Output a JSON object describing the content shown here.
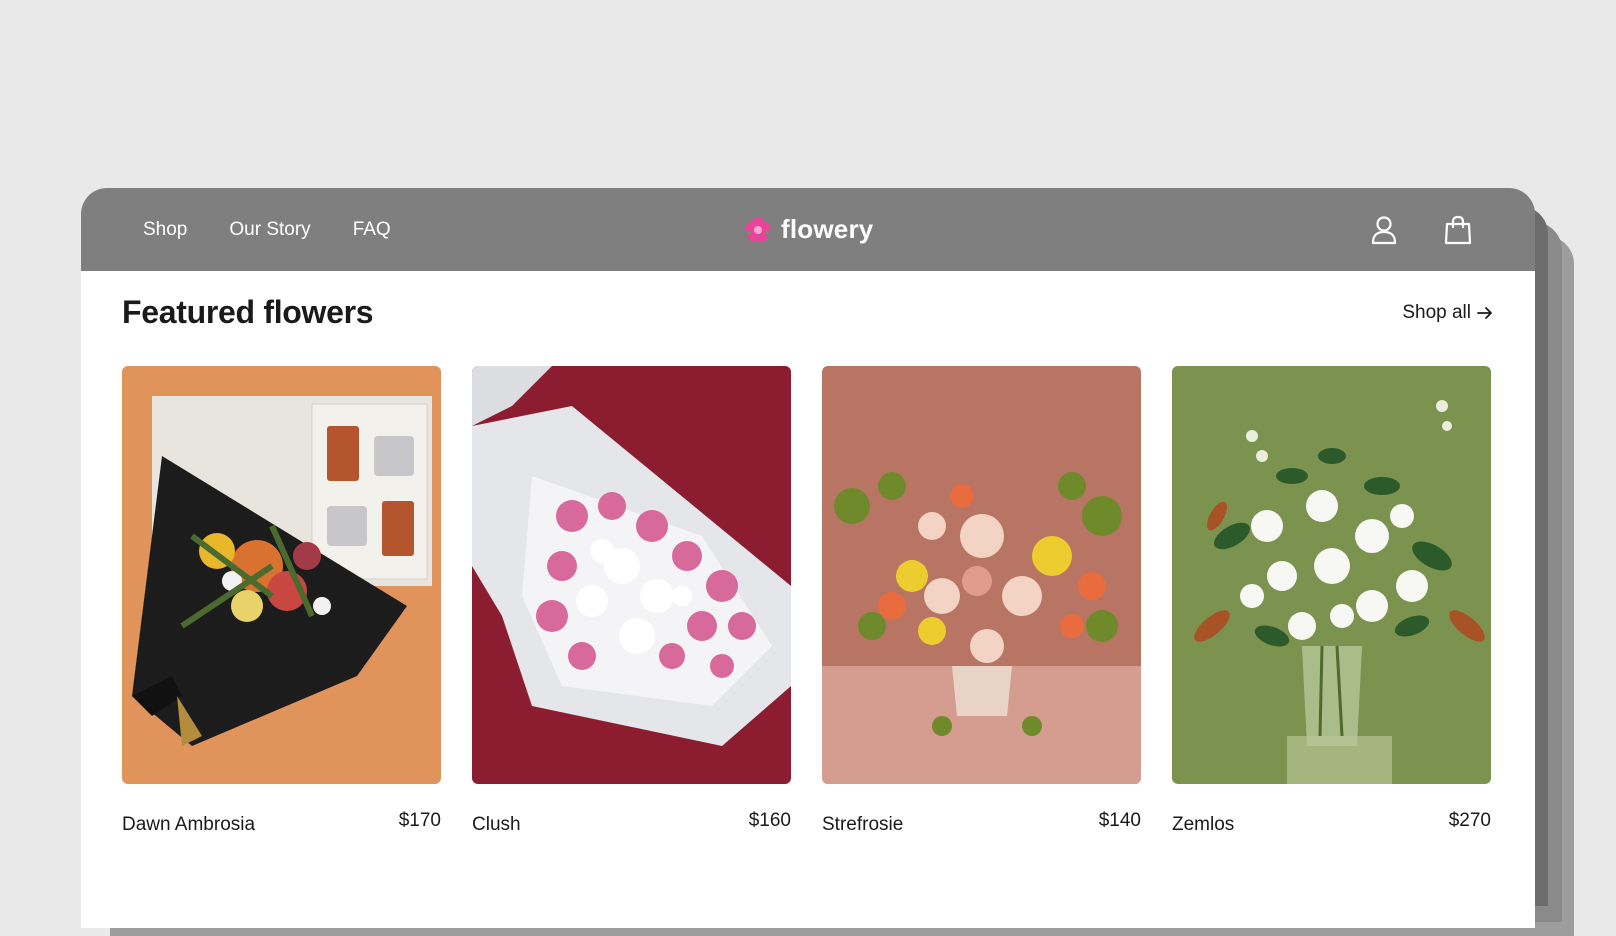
{
  "nav": {
    "links": [
      "Shop",
      "Our Story",
      "FAQ"
    ],
    "brand": "flowery"
  },
  "header_icons": [
    "user-icon",
    "shopping-bag-icon"
  ],
  "featured": {
    "title": "Featured flowers",
    "shop_all": "Shop all",
    "products": [
      {
        "name": "Dawn Ambrosia",
        "price": "$170"
      },
      {
        "name": "Clush",
        "price": "$160"
      },
      {
        "name": "Strefrosie",
        "price": "$140"
      },
      {
        "name": "Zemlos",
        "price": "$270"
      }
    ]
  },
  "colors": {
    "page_bg": "#e9e9e9",
    "header_bg": "#7f7f7f",
    "brand_accent": "#e8449a",
    "card1_bg": "#e0935a",
    "card2_bg": "#8c1d31",
    "card3_bg": "#b87563",
    "card4_bg": "#7c9350"
  }
}
